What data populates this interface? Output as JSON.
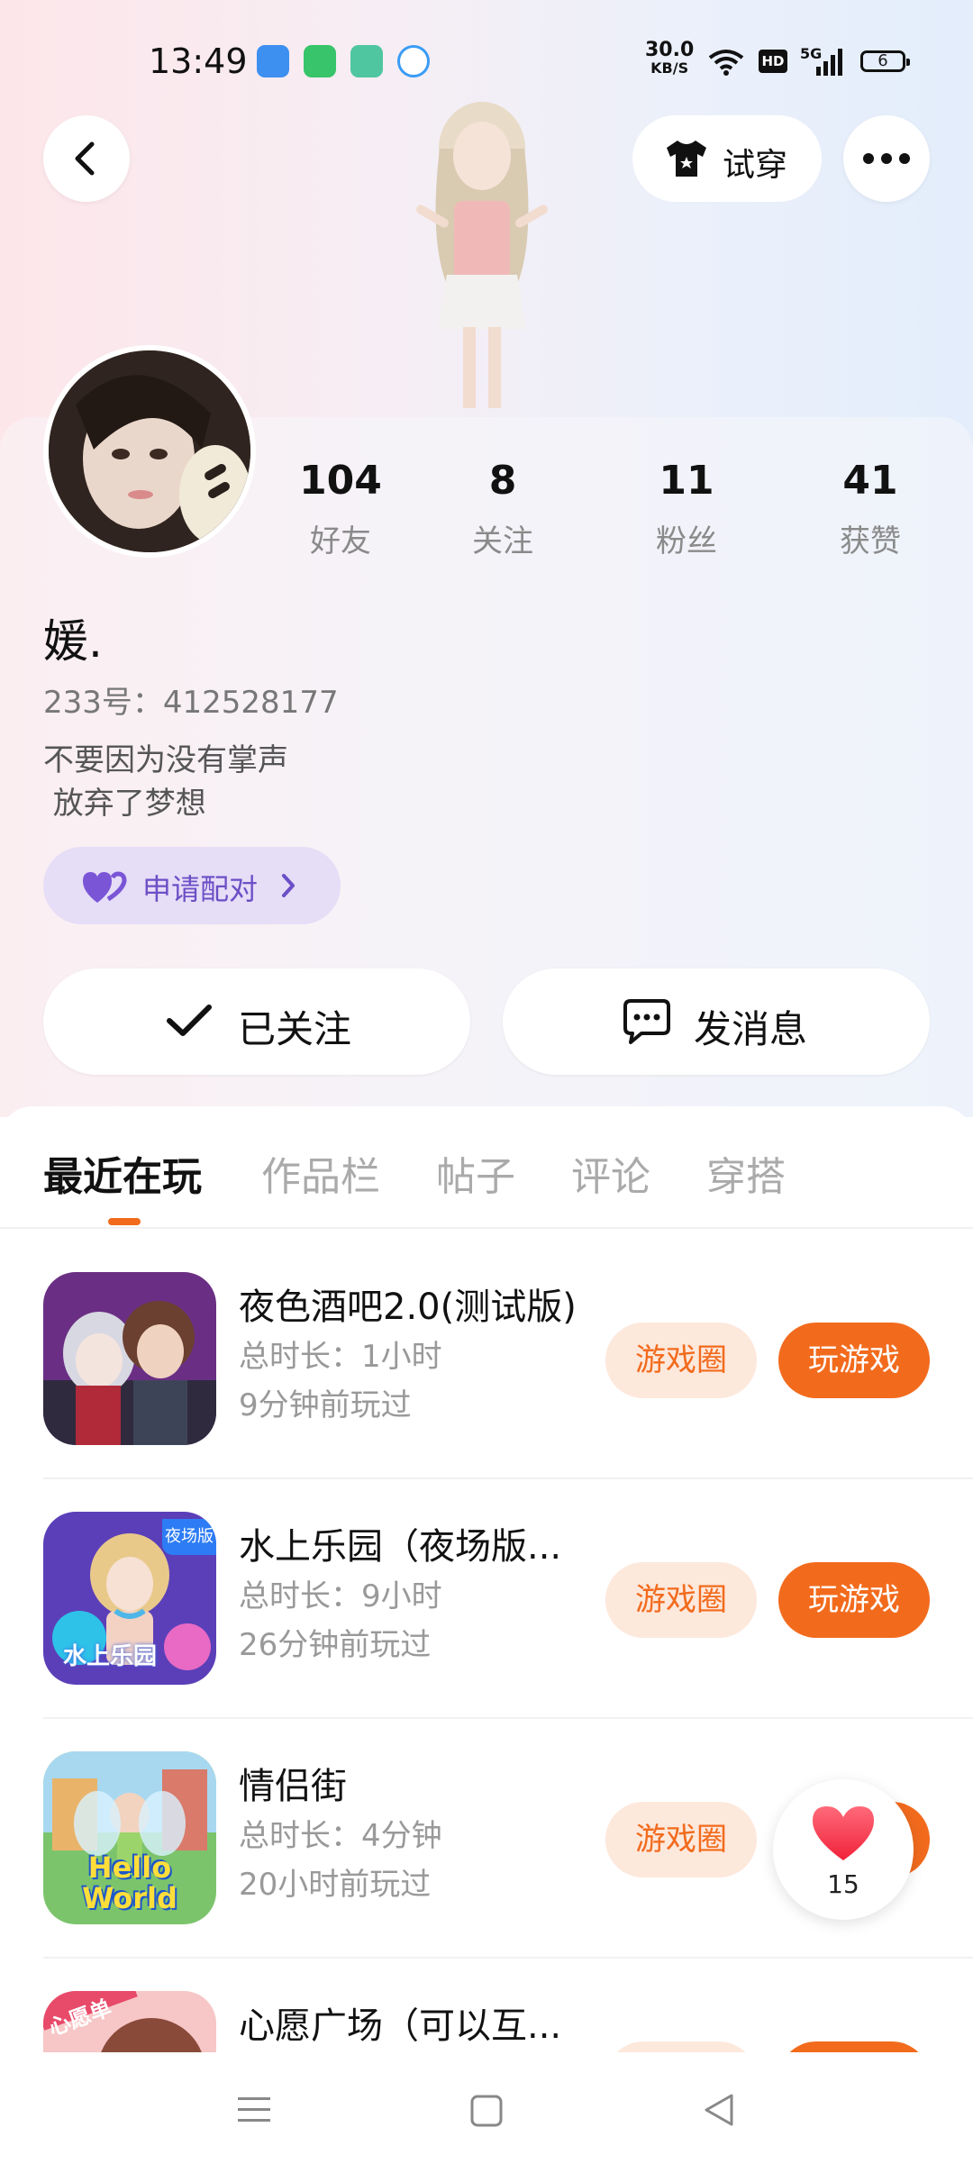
{
  "status_bar": {
    "time": "13:49",
    "net_speed_value": "30.0",
    "net_speed_unit": "KB/S",
    "hd": "HD",
    "signal": "5G",
    "battery": "6"
  },
  "header": {
    "tryon_label": "试穿"
  },
  "profile": {
    "stats": [
      {
        "value": "104",
        "label": "好友"
      },
      {
        "value": "8",
        "label": "关注"
      },
      {
        "value": "11",
        "label": "粉丝"
      },
      {
        "value": "41",
        "label": "获赞"
      }
    ],
    "nickname": "媛.",
    "uid": "233号：412528177",
    "bio": "不要因为没有掌声\n 放弃了梦想",
    "match_label": "申请配对"
  },
  "actions": {
    "followed_label": "已关注",
    "message_label": "发消息"
  },
  "tabs": [
    {
      "label": "最近在玩",
      "active": true
    },
    {
      "label": "作品栏",
      "active": false
    },
    {
      "label": "帖子",
      "active": false
    },
    {
      "label": "评论",
      "active": false
    },
    {
      "label": "穿搭",
      "active": false
    }
  ],
  "games": [
    {
      "title": "夜色酒吧2.0(测试版)",
      "duration": "总时长：1小时",
      "last_played": "9分钟前玩过"
    },
    {
      "title": "水上乐园（夜场版...",
      "duration": "总时长：9小时",
      "last_played": "26分钟前玩过",
      "icon_text": "水上乐园",
      "icon_badge": "夜场版"
    },
    {
      "title": "情侣街",
      "duration": "总时长：4分钟",
      "last_played": "20小时前玩过",
      "icon_text": "Hello World"
    },
    {
      "title": "心愿广场（可以互...",
      "icon_badge": "心愿单"
    }
  ],
  "game_buttons": {
    "circle_label": "游戏圈",
    "play_label": "玩游戏"
  },
  "like": {
    "count": "15"
  },
  "colors": {
    "accent": "#f26b1d",
    "accent_light": "#fde8dc",
    "match_bg": "#e6ddf7",
    "match_text": "#6b4fc6"
  }
}
